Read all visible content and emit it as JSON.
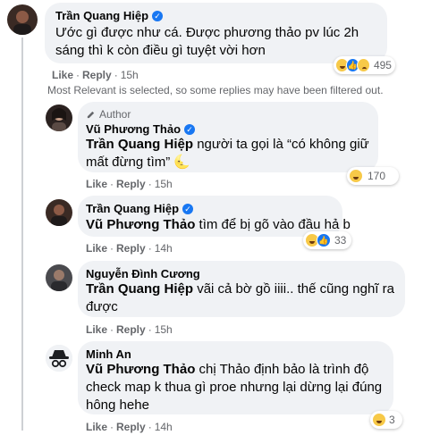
{
  "comments": [
    {
      "author": "Trần Quang Hiệp",
      "verified": true,
      "text": "Ước gì được như cá. Được phương thảo pv lúc 2h sáng thì k còn điều gì tuyệt vời hơn",
      "like": "Like",
      "reply": "Reply",
      "time": "15h",
      "reaction_icons": [
        "haha-icon",
        "like-icon",
        "sad-icon"
      ],
      "reaction_count": "495"
    }
  ],
  "relevance_notice": "Most Relevant is selected, so some replies may have been filtered out.",
  "replies": [
    {
      "author_tag": "Author",
      "author": "Vũ Phương Thảo",
      "verified": true,
      "mention": "Trần Quang Hiệp",
      "text": "người ta gọi là “có không giữ mất đừng tìm”",
      "trailing_emoji": "🌜",
      "like": "Like",
      "reply": "Reply",
      "time": "15h",
      "reaction_icons": [
        "haha-icon"
      ],
      "reaction_count": "170"
    },
    {
      "author": "Trần Quang Hiệp",
      "verified": true,
      "mention": "Vũ Phương Thảo",
      "text": "tìm để bị gõ vào đầu hả b",
      "like": "Like",
      "reply": "Reply",
      "time": "14h",
      "reaction_icons": [
        "haha-icon",
        "like-icon"
      ],
      "reaction_count": "33"
    },
    {
      "author": "Nguyễn Đình Cương",
      "verified": false,
      "mention": "Trần Quang Hiệp",
      "text": "vãi cả bờ gồ iiii.. thế cũng nghĩ ra được",
      "like": "Like",
      "reply": "Reply",
      "time": "15h"
    },
    {
      "author": "Minh An",
      "verified": false,
      "mention": "Vũ Phương Thảo",
      "text": "chị Thảo định bảo là trình độ check map k thua gì proe nhưng lại dừng lại đúng hông hehe",
      "like": "Like",
      "reply": "Reply",
      "time": "14h",
      "reaction_icons": [
        "haha-icon"
      ],
      "reaction_count": "3"
    }
  ],
  "colors": {
    "bubble": "#f0f2f5",
    "meta_text": "#65676b",
    "verified_badge": "#1877f2"
  }
}
